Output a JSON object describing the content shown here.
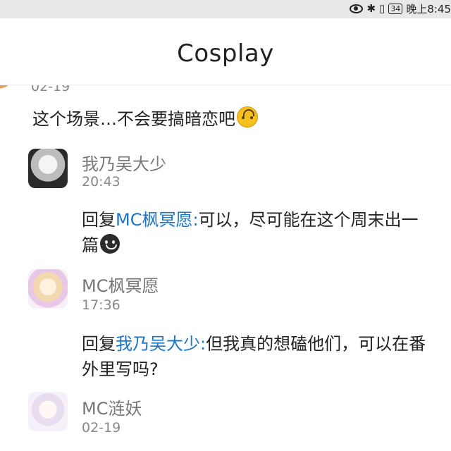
{
  "status_bar": {
    "icons": [
      "eye-icon",
      "bluetooth-icon",
      "vibrate-icon",
      "battery-icon"
    ],
    "battery": "34",
    "time": "晚上8:45"
  },
  "header": {
    "title": "Cosplay"
  },
  "comments": [
    {
      "time": "02-19",
      "text": "这个场景…不会要搞暗恋吧",
      "emoji": "upside-down-face"
    },
    {
      "user": "我乃吴大少",
      "time": "20:43",
      "reply_prefix": "回复",
      "mention": "MC枫冥愿:",
      "text": "可以，尽可能在这个周末出一篇",
      "emoji": "dark-smile"
    },
    {
      "user": "MC枫冥愿",
      "time": "17:36",
      "reply_prefix": "回复",
      "mention": "我乃吴大少:",
      "text": "但我真的想磕他们，可以在番外里写吗?"
    },
    {
      "user": "MC涟妖",
      "time": "02-19"
    }
  ],
  "colors": {
    "mention": "#1b74c8",
    "status_bar_bg": "#e8e8e8",
    "secondary_text": "#888888"
  }
}
